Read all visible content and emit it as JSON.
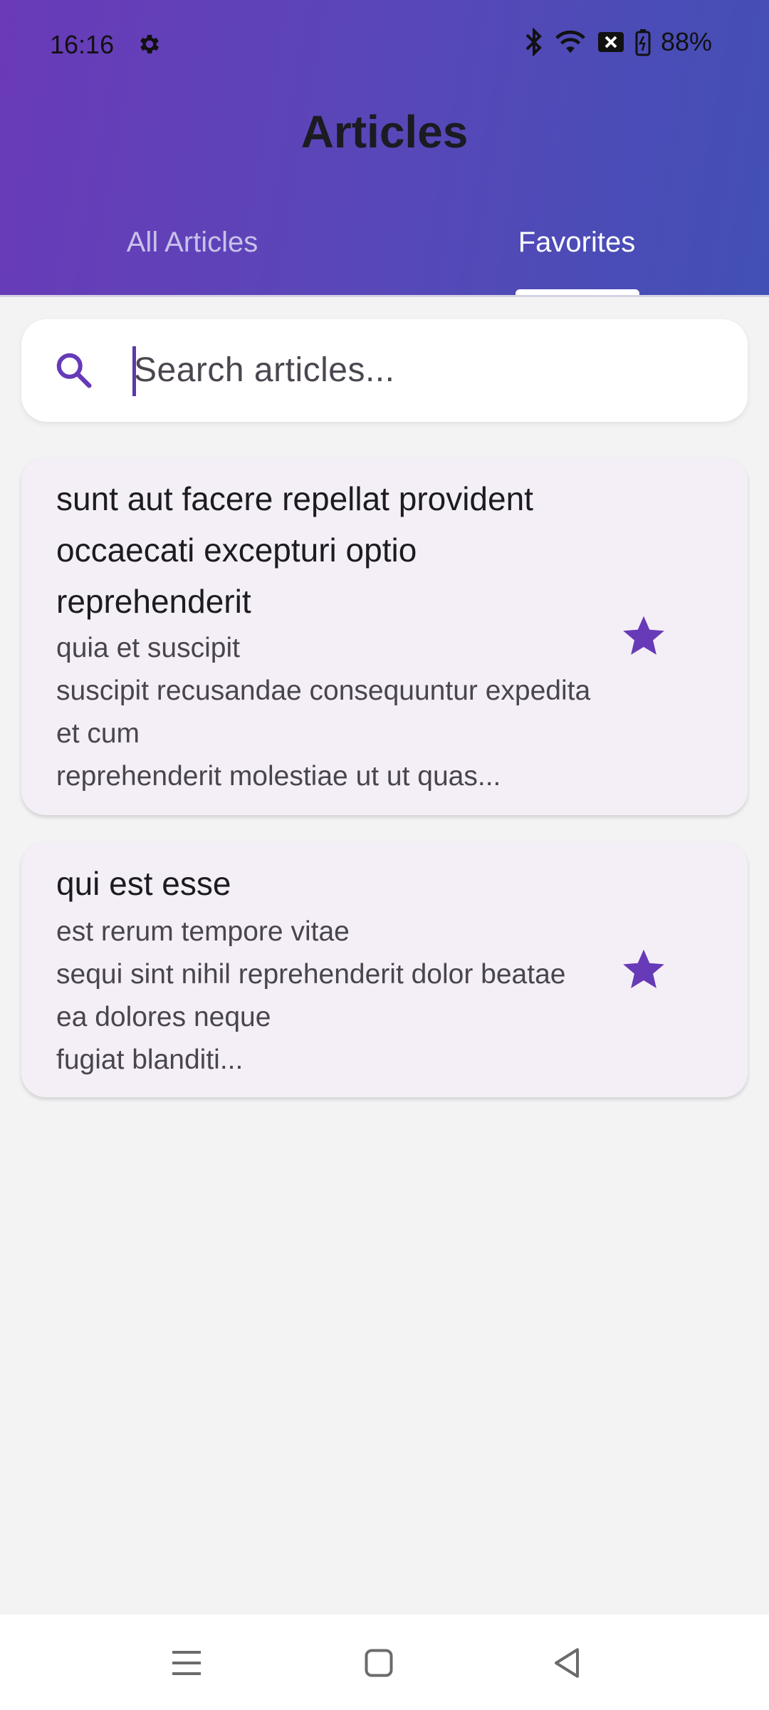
{
  "status_bar": {
    "time": "16:16",
    "battery": "88%",
    "icons": [
      "gear-icon",
      "bluetooth-icon",
      "wifi-icon",
      "sim-off-icon",
      "battery-icon"
    ]
  },
  "app": {
    "title": "Articles"
  },
  "tabs": [
    {
      "label": "All Articles",
      "active": false
    },
    {
      "label": "Favorites",
      "active": true
    }
  ],
  "search": {
    "placeholder": "Search articles...",
    "value": "",
    "icon": "search-icon"
  },
  "articles": [
    {
      "title": "sunt aut facere repellat provident occaecati excepturi optio reprehenderit",
      "body": "quia et suscipit\nsuscipit recusandae consequuntur expedita et cum\nreprehenderit molestiae ut ut quas...",
      "favorite": true
    },
    {
      "title": "qui est esse",
      "body": "est rerum tempore vitae\nsequi sint nihil reprehenderit dolor beatae ea dolores neque\nfugiat blanditi...",
      "favorite": true
    }
  ],
  "nav_bar": {
    "buttons": [
      "menu-icon",
      "home-icon",
      "back-icon"
    ]
  },
  "colors": {
    "accent": "#673ab7",
    "header_gradient_start": "#6a3ab8",
    "header_gradient_end": "#4250b6",
    "card_bg": "#f4eff6",
    "background": "#f4f3f4"
  }
}
